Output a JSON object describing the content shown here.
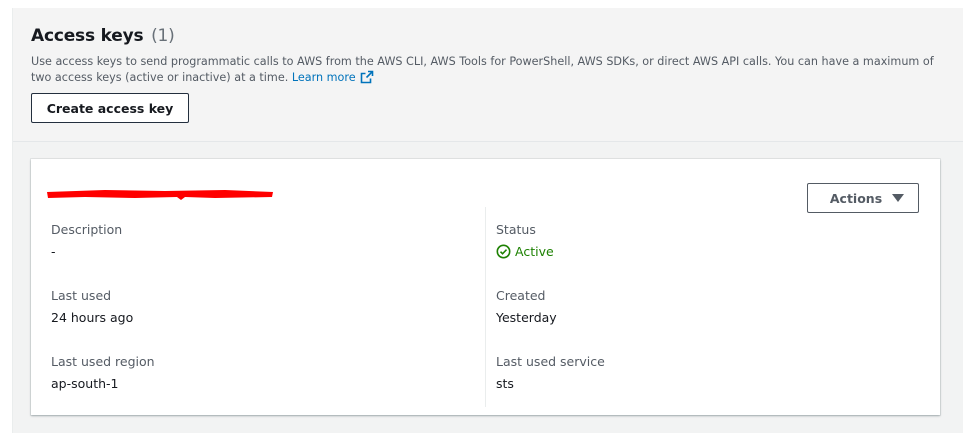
{
  "header": {
    "title": "Access keys",
    "count": "(1)",
    "description": "Use access keys to send programmatic calls to AWS from the AWS CLI, AWS Tools for PowerShell, AWS SDKs, or direct AWS API calls. You can have a maximum of two access keys (active or inactive) at a time.",
    "learn_more": "Learn more",
    "create_button": "Create access key"
  },
  "key": {
    "actions_label": "Actions",
    "fields": {
      "description_label": "Description",
      "description_value": "-",
      "last_used_label": "Last used",
      "last_used_value": "24 hours ago",
      "region_label": "Last used region",
      "region_value": "ap-south-1",
      "status_label": "Status",
      "status_value": "Active",
      "created_label": "Created",
      "created_value": "Yesterday",
      "service_label": "Last used service",
      "service_value": "sts"
    }
  },
  "colors": {
    "link": "#0073bb",
    "active_status": "#1d8102",
    "redaction": "#ff0000"
  },
  "icons": {
    "external_link": "external-link-icon",
    "status": "check-circle-icon",
    "dropdown": "caret-down-icon"
  }
}
